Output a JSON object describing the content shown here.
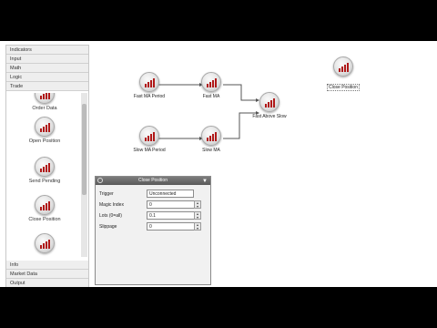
{
  "sidebar": {
    "categories_top": [
      {
        "label": "Indicators"
      },
      {
        "label": "Input"
      },
      {
        "label": "Math"
      },
      {
        "label": "Logic"
      },
      {
        "label": "Trade"
      }
    ],
    "items": [
      {
        "label": "Order Data"
      },
      {
        "label": "Open Position"
      },
      {
        "label": "Send Pending"
      },
      {
        "label": "Close Position"
      },
      {
        "label": ""
      }
    ],
    "categories_bottom": [
      {
        "label": "Info"
      },
      {
        "label": "Market Data"
      },
      {
        "label": "Output"
      }
    ]
  },
  "canvas": {
    "nodes": [
      {
        "label": "Fast MA Period"
      },
      {
        "label": "Fast MA"
      },
      {
        "label": "Slow MA Period"
      },
      {
        "label": "Slow MA"
      },
      {
        "label": "Fast Above Slow"
      },
      {
        "label": "Close Position"
      }
    ]
  },
  "props": {
    "title": "Close Position",
    "fields": [
      {
        "label": "Trigger",
        "value": "Unconnected"
      },
      {
        "label": "Magic Index",
        "value": "0"
      },
      {
        "label": "Lots (0=all)",
        "value": "0.1"
      },
      {
        "label": "Slippage",
        "value": "0"
      }
    ]
  },
  "colors": {
    "node_bars": "#b01818",
    "wire": "#555555"
  }
}
